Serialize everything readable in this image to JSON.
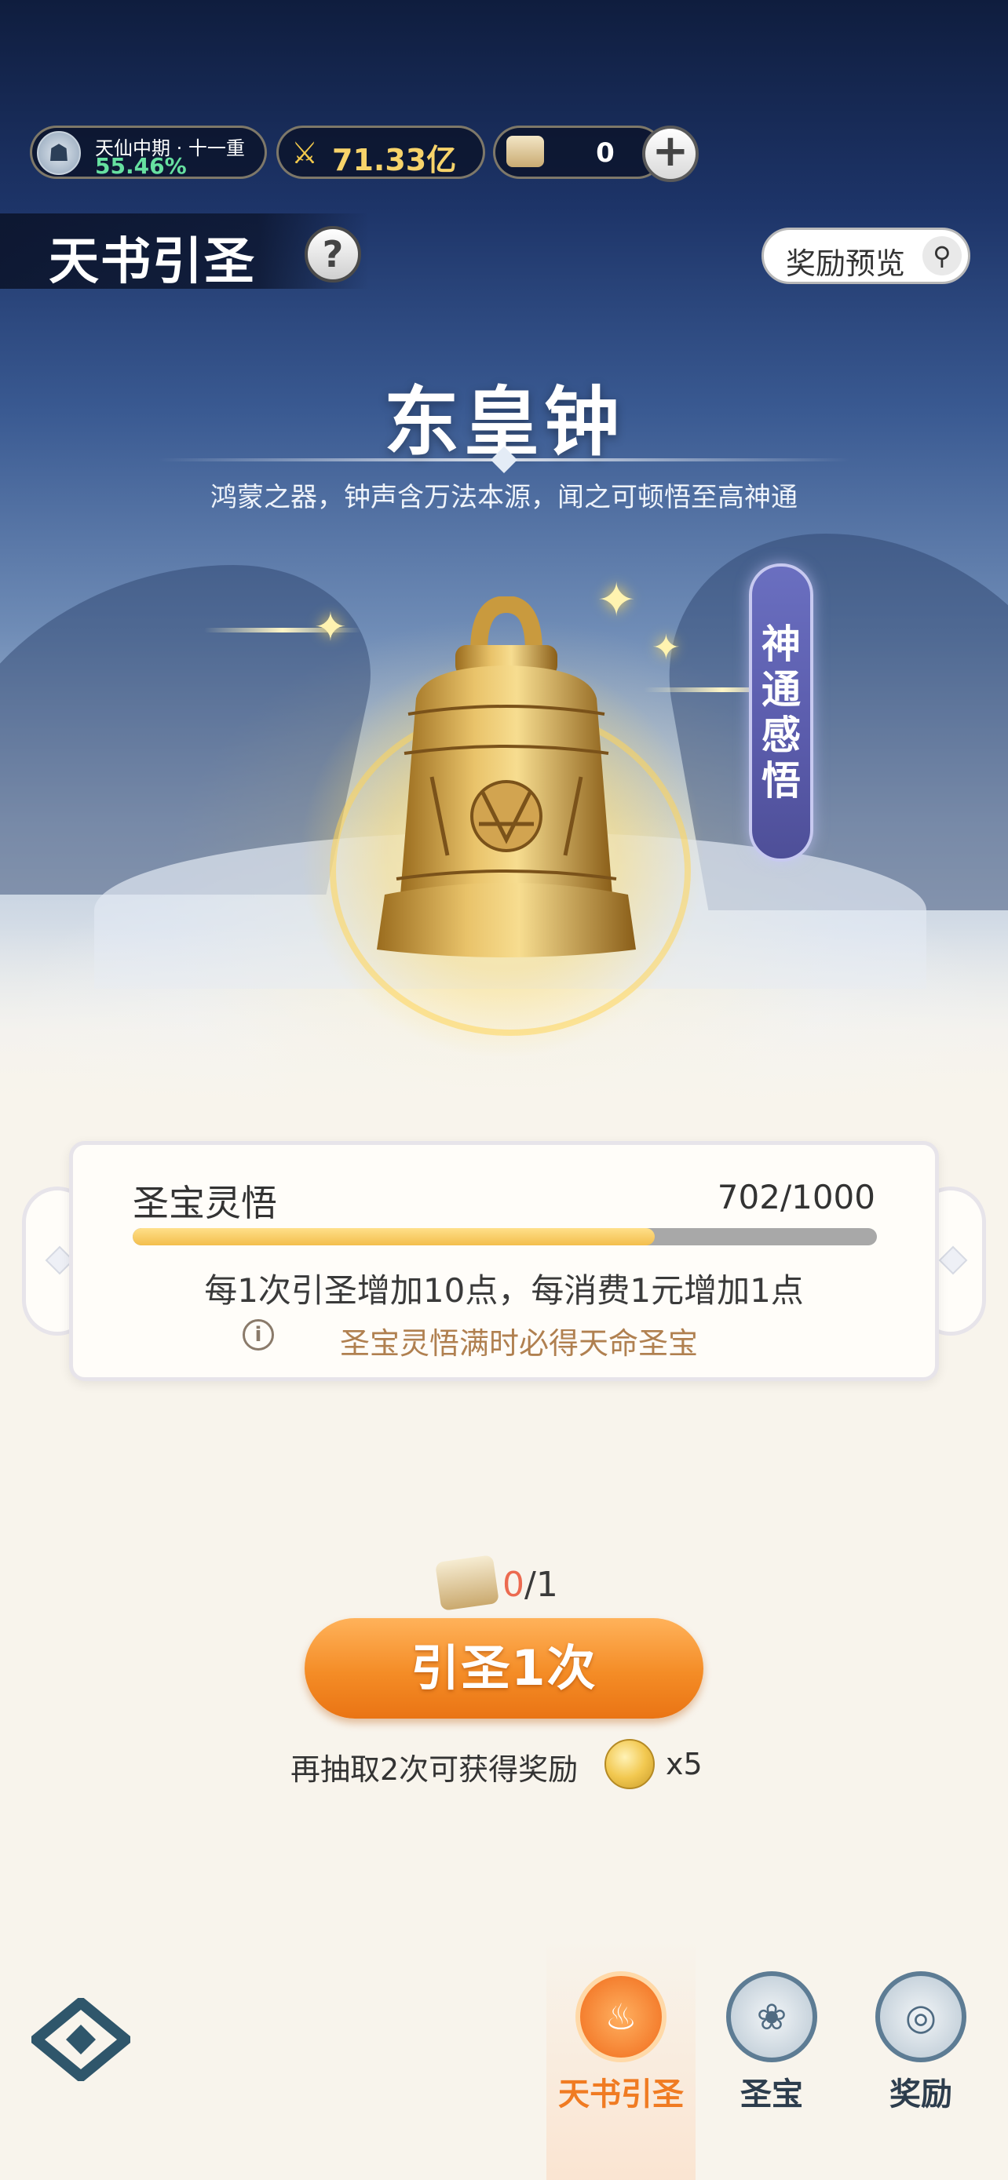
{
  "topbar": {
    "rank_label": "天仙中期 · 十一重",
    "rank_progress": "55.46%",
    "power_value": "71.33亿",
    "scroll_count": "0",
    "plus_label": "+"
  },
  "header": {
    "title": "天书引圣",
    "help_label": "?",
    "preview_label": "奖励预览"
  },
  "treasure": {
    "name": "东皇钟",
    "description": "鸿蒙之器，钟声含万法本源，闻之可顿悟至高神通",
    "side_button": "神\n通\n感\n悟"
  },
  "progress": {
    "label": "圣宝灵悟",
    "value_text": "702/1000",
    "fraction": 0.702,
    "rule": "每1次引圣增加10点，每消费1元增加1点",
    "note_icon": "i",
    "note": "圣宝灵悟满时必得天命圣宝"
  },
  "draw": {
    "have": "0",
    "need": "/1",
    "button_label": "引圣1次",
    "extra_text": "再抽取2次可获得奖励",
    "reward_multiplier": "x5"
  },
  "nav": {
    "items": [
      {
        "label": "天书引圣",
        "active": true
      },
      {
        "label": "圣宝",
        "active": false
      },
      {
        "label": "奖励",
        "active": false
      }
    ]
  },
  "colors": {
    "accent_orange": "#f48c26",
    "progress_fill": "#f3be4c",
    "progress_track": "#a8a8a8",
    "note_text": "#b08050"
  }
}
